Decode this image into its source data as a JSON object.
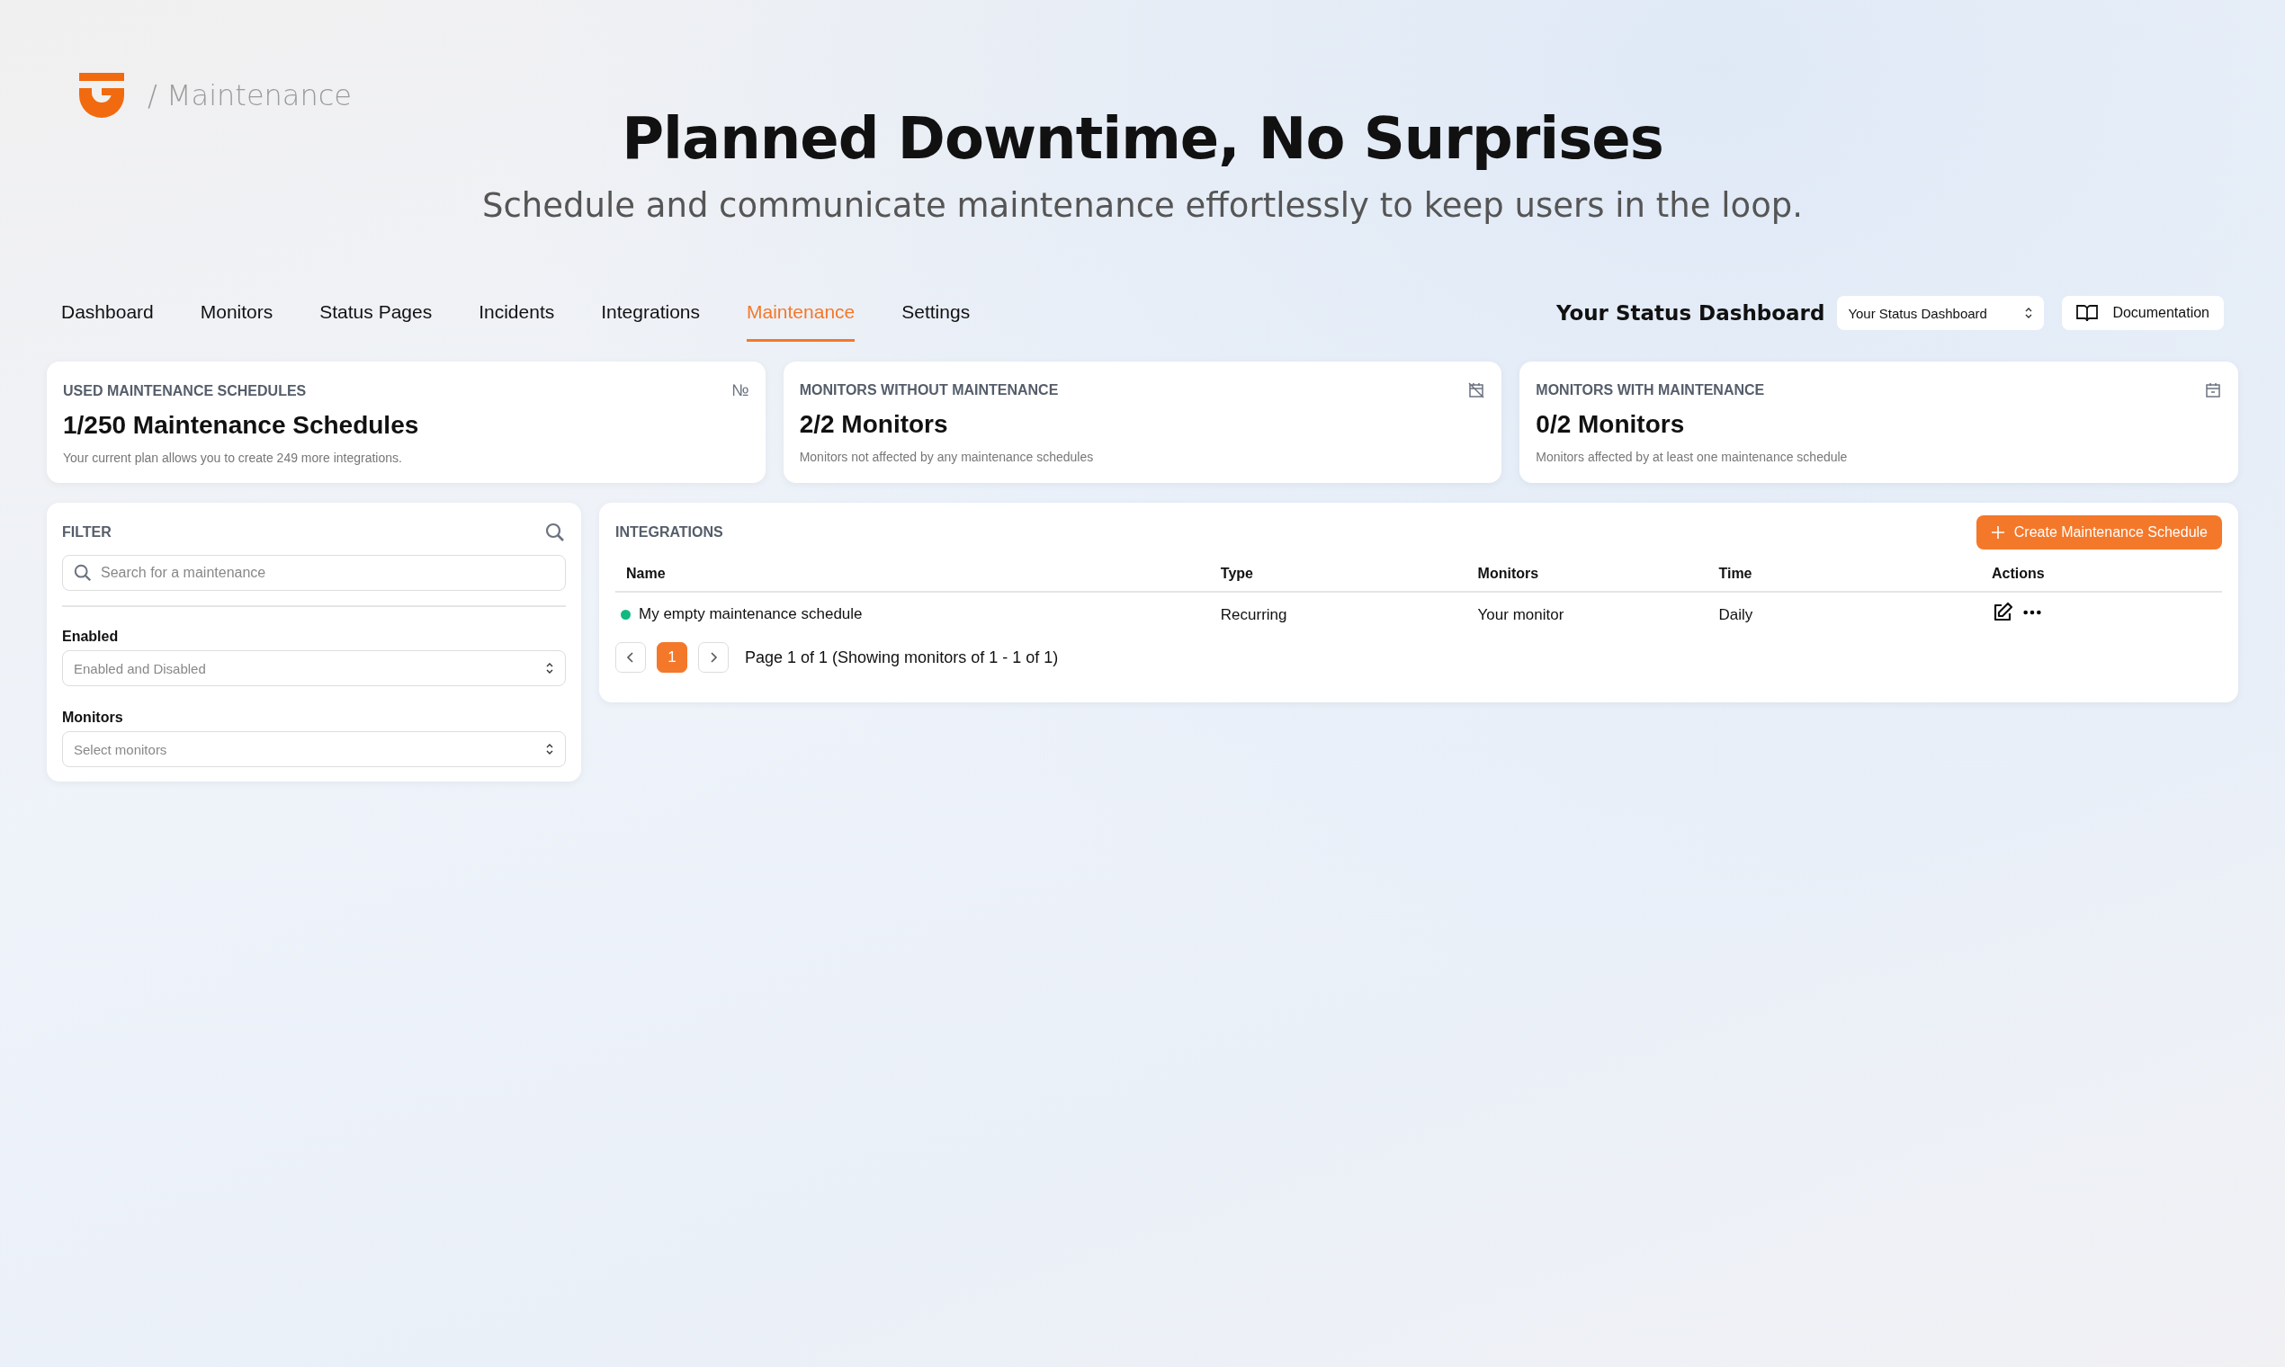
{
  "brand": {
    "breadcrumb": "/ Maintenance"
  },
  "hero": {
    "title": "Planned Downtime, No Surprises",
    "subtitle": "Schedule and communicate maintenance effortlessly to keep users in the loop."
  },
  "nav": {
    "tabs": [
      {
        "label": "Dashboard",
        "selected": false
      },
      {
        "label": "Monitors",
        "selected": false
      },
      {
        "label": "Status Pages",
        "selected": false
      },
      {
        "label": "Incidents",
        "selected": false
      },
      {
        "label": "Integrations",
        "selected": false
      },
      {
        "label": "Maintenance",
        "selected": true
      },
      {
        "label": "Settings",
        "selected": false
      }
    ],
    "dashboard_title": "Your Status Dashboard",
    "dashboard_select": "Your Status Dashboard",
    "docs_button": "Documentation"
  },
  "stats": [
    {
      "label": "USED MAINTENANCE SCHEDULES",
      "value": "1/250 Maintenance Schedules",
      "note": "Your current plan allows you to create 249 more integrations.",
      "symbol": "№"
    },
    {
      "label": "MONITORS WITHOUT MAINTENANCE",
      "value": "2/2 Monitors",
      "note": "Monitors not affected by any maintenance schedules"
    },
    {
      "label": "MONITORS WITH MAINTENANCE",
      "value": "0/2 Monitors",
      "note": "Monitors affected by at least one maintenance schedule"
    }
  ],
  "filter": {
    "title": "FILTER",
    "search_placeholder": "Search for a maintenance",
    "enabled_label": "Enabled",
    "enabled_value": "Enabled and Disabled",
    "monitors_label": "Monitors",
    "monitors_placeholder": "Select monitors"
  },
  "table": {
    "title": "INTEGRATIONS",
    "create_button": "Create Maintenance Schedule",
    "columns": [
      "Name",
      "Type",
      "Monitors",
      "Time",
      "Actions"
    ],
    "rows": [
      {
        "name": "My empty maintenance schedule",
        "enabled": true,
        "type": "Recurring",
        "monitors": "Your monitor",
        "time": "Daily"
      }
    ],
    "pages": [
      {
        "label": "1",
        "selected": true
      }
    ],
    "page_info": "Page 1 of 1 (Showing monitors of 1 - 1 of 1)"
  }
}
